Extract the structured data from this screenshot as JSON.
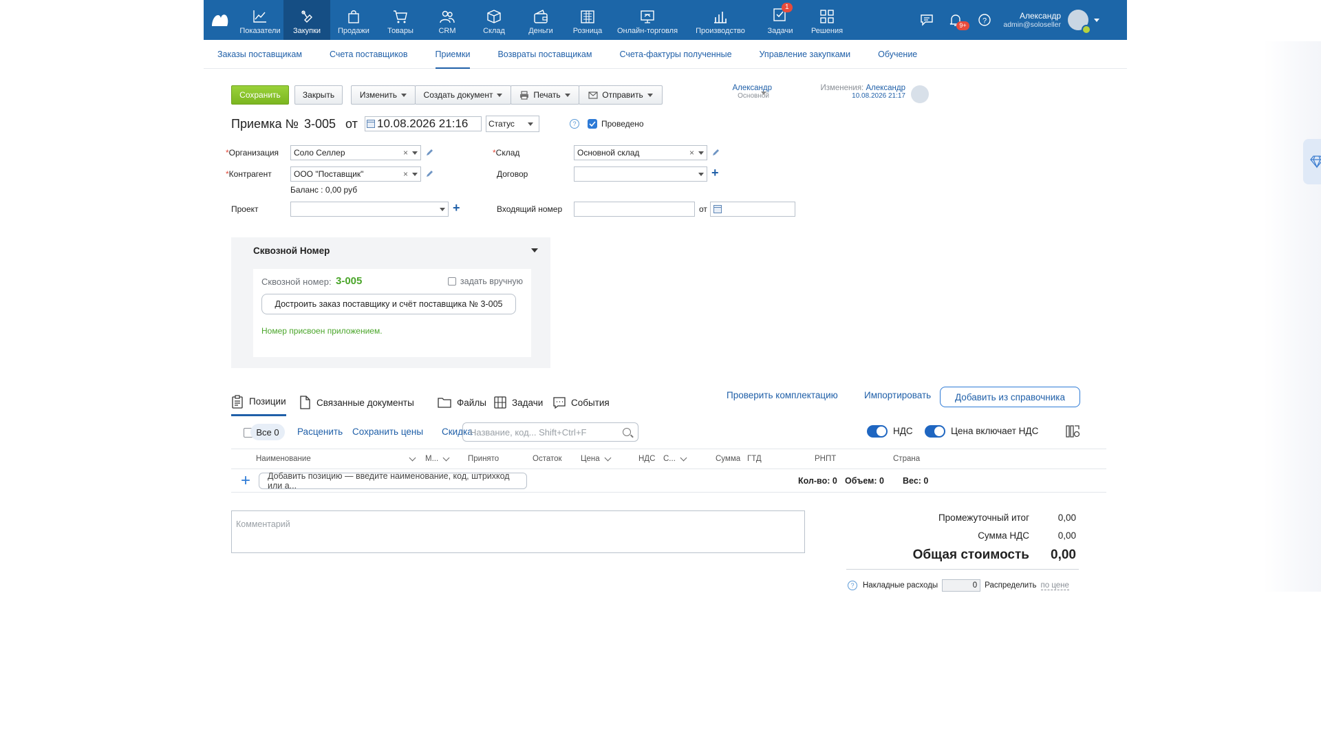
{
  "topnav": {
    "items": [
      {
        "label": "Показатели",
        "icon": "chart-line-icon"
      },
      {
        "label": "Закупки",
        "icon": "purchase-icon",
        "active": true
      },
      {
        "label": "Продажи",
        "icon": "shopping-bag-icon"
      },
      {
        "label": "Товары",
        "icon": "cart-icon"
      },
      {
        "label": "CRM",
        "icon": "people-icon"
      },
      {
        "label": "Склад",
        "icon": "box-icon"
      },
      {
        "label": "Деньги",
        "icon": "wallet-icon"
      },
      {
        "label": "Розница",
        "icon": "register-icon"
      },
      {
        "label": "Онлайн-торговля",
        "icon": "online-store-icon"
      },
      {
        "label": "Производство",
        "icon": "factory-icon"
      },
      {
        "label": "Задачи",
        "icon": "tasks-icon",
        "badge": "1"
      },
      {
        "label": "Решения",
        "icon": "grid-icon"
      }
    ],
    "notifications_badge": "9+",
    "user_name": "Александр",
    "user_email": "admin@soloseller"
  },
  "subnav": {
    "items": [
      "Заказы поставщикам",
      "Счета поставщиков",
      "Приемки",
      "Возвраты поставщикам",
      "Счета-фактуры полученные",
      "Управление закупками",
      "Обучение"
    ],
    "active": "Приемки"
  },
  "toolbar": {
    "save": "Сохранить",
    "close": "Закрыть",
    "change": "Изменить",
    "create_doc": "Создать документ",
    "print": "Печать",
    "send": "Отправить"
  },
  "owner": {
    "name": "Александр",
    "role": "Основной",
    "changed_label": "Изменения:",
    "changed_by": "Александр",
    "changed_at": "10.08.2026 21:17"
  },
  "doc": {
    "title_prefix": "Приемка №",
    "number": "3-005",
    "from": "от",
    "datetime": "10.08.2026 21:16",
    "status_label": "Статус",
    "posted_label": "Проведено"
  },
  "form": {
    "org_label": "Организация",
    "org_value": "Соло Селлер",
    "warehouse_label": "Склад",
    "warehouse_value": "Основной склад",
    "contractor_label": "Контрагент",
    "contractor_value": "ООО \"Поставщик\"",
    "contract_label": "Договор",
    "contract_value": "",
    "balance_text": "Баланс : 0,00 руб",
    "project_label": "Проект",
    "project_value": "",
    "incoming_label": "Входящий номер",
    "incoming_value": "",
    "incoming_from": "от"
  },
  "through": {
    "header": "Сквозной Номер",
    "label": "Сквозной номер:",
    "number": "3-005",
    "manual_label": "задать вручную",
    "button": "Достроить заказ поставщику и счёт поставщика № 3-005",
    "note": "Номер присвоен приложением."
  },
  "tabs": [
    {
      "label": "Позиции",
      "icon": "clipboard-icon"
    },
    {
      "label": "Связанные документы",
      "icon": "document-icon"
    },
    {
      "label": "Файлы",
      "icon": "folder-icon"
    },
    {
      "label": "Задачи",
      "icon": "task-list-icon"
    },
    {
      "label": "События",
      "icon": "chat-icon"
    }
  ],
  "tab_actions": {
    "check": "Проверить комплектацию",
    "import": "Импортировать",
    "add_ref": "Добавить из справочника"
  },
  "positions": {
    "all_pill": "Все 0",
    "reprice": "Расценить",
    "save_prices": "Сохранить цены",
    "discount": "Скидка",
    "search_placeholder": "Название, код... Shift+Ctrl+F",
    "vat_label": "НДС",
    "price_incl_vat_label": "Цена включает НДС"
  },
  "table": {
    "columns": [
      "Наименование",
      "М...",
      "Принято",
      "Остаток",
      "Цена",
      "НДС",
      "С...",
      "Сумма",
      "ГТД",
      "РНПТ",
      "Страна"
    ],
    "add_placeholder": "Добавить позицию — введите наименование, код, штрихкод или а...",
    "qty_label": "Кол-во: 0",
    "volume_label": "Объем: 0",
    "weight_label": "Вес: 0"
  },
  "comment_placeholder": "Комментарий",
  "totals": {
    "subtotal_label": "Промежуточный итог",
    "subtotal_value": "0,00",
    "vat_sum_label": "Сумма НДС",
    "vat_sum_value": "0,00",
    "total_label": "Общая стоимость",
    "total_value": "0,00",
    "overhead_label": "Накладные расходы",
    "overhead_value": "0",
    "distribute_label": "Распределить",
    "distribute_by": "по цене"
  }
}
